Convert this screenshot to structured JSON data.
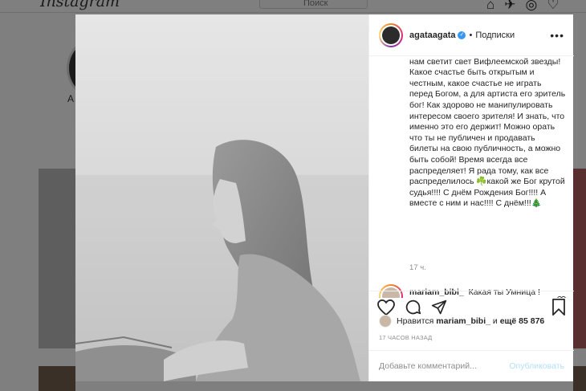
{
  "background": {
    "logo": "Instagram",
    "search_placeholder": "Поиск",
    "profile_initial": "А"
  },
  "post": {
    "author": "agataagata",
    "verified": true,
    "follow_label": "Подписки",
    "caption": "преданных с Рождеством, ибо только нам светит свет Вифлеемской звезды! Какое счастье быть открытым и честным, какое счастье не играть перед Богом, а для артиста его зритель бог! Как здорово не манипулировать интересом своего зрителя! И знать, что именно это его держит! Можно орать что ты не публичен и продавать билеты на свою публичность, а можно быть собой! Время всегда все распределяет! Я рада тому, как все распределилось ☘️какой же Бог крутой судья!!!! С днём Рождения Бог!!!! А вместе с ним и нас!!!! С днём!!!🎄",
    "caption_time": "17 ч.",
    "comment": {
      "user": "mariam_bibi_",
      "text": "Какая ты Умница !"
    },
    "likes": {
      "prefix": "Нравится",
      "user": "mariam_bibi_",
      "and": "и",
      "rest": "ещё 85 876"
    },
    "timestamp": "17 ЧАСОВ НАЗАД",
    "comment_placeholder": "Добавьте комментарий...",
    "publish_label": "Опубликовать"
  },
  "icons": {
    "header_more": "more-icon",
    "like": "heart-icon",
    "comment": "comment-icon",
    "share": "share-icon",
    "save": "bookmark-icon",
    "comment_like": "heart-icon"
  },
  "colors": {
    "verified": "#3897f0",
    "publish_disabled": "#b2dffc",
    "muted_text": "#8e8e8e"
  }
}
